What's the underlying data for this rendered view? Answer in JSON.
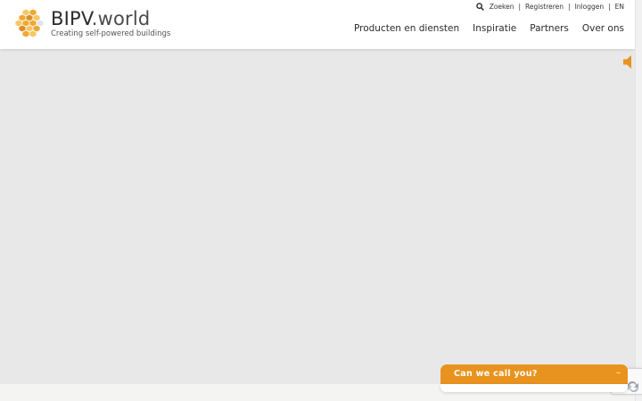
{
  "brand": {
    "name_strong": "BIPV",
    "name_light": ".world",
    "tagline": "Creating self-powered buildings",
    "colors": {
      "honey": "#f0a830",
      "honey_dark": "#d9902a",
      "cell_light": "#f7c766"
    }
  },
  "topbar": {
    "search_label": "Zoeken",
    "register_label": "Registreren",
    "login_label": "Inloggen",
    "language_label": "EN"
  },
  "nav": {
    "items": [
      {
        "label": "Producten en diensten"
      },
      {
        "label": "Inspiratie"
      },
      {
        "label": "Partners"
      },
      {
        "label": "Over ons"
      }
    ]
  },
  "hero": {
    "background": "#e8e8e8"
  },
  "sound": {
    "icon": "speaker-icon",
    "color": "#e8931f"
  },
  "chat": {
    "title": "Can we call you?",
    "minimize_label": "–",
    "accent": "#e8931f"
  }
}
